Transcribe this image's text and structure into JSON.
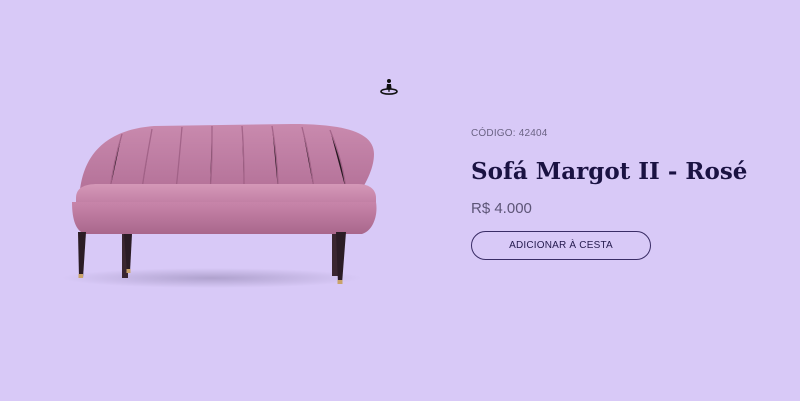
{
  "colors": {
    "background": "#d8c9f7",
    "title": "#1a1242",
    "sofa_fabric": "#c57fa8"
  },
  "product": {
    "code_label": "CÓDIGO:",
    "code_value": "42404",
    "name": "Sofá Margot II - Rosé",
    "price": "R$ 4.000",
    "cta_label": "ADICIONAR À CESTA",
    "ar_icon": "ar-view-icon"
  }
}
